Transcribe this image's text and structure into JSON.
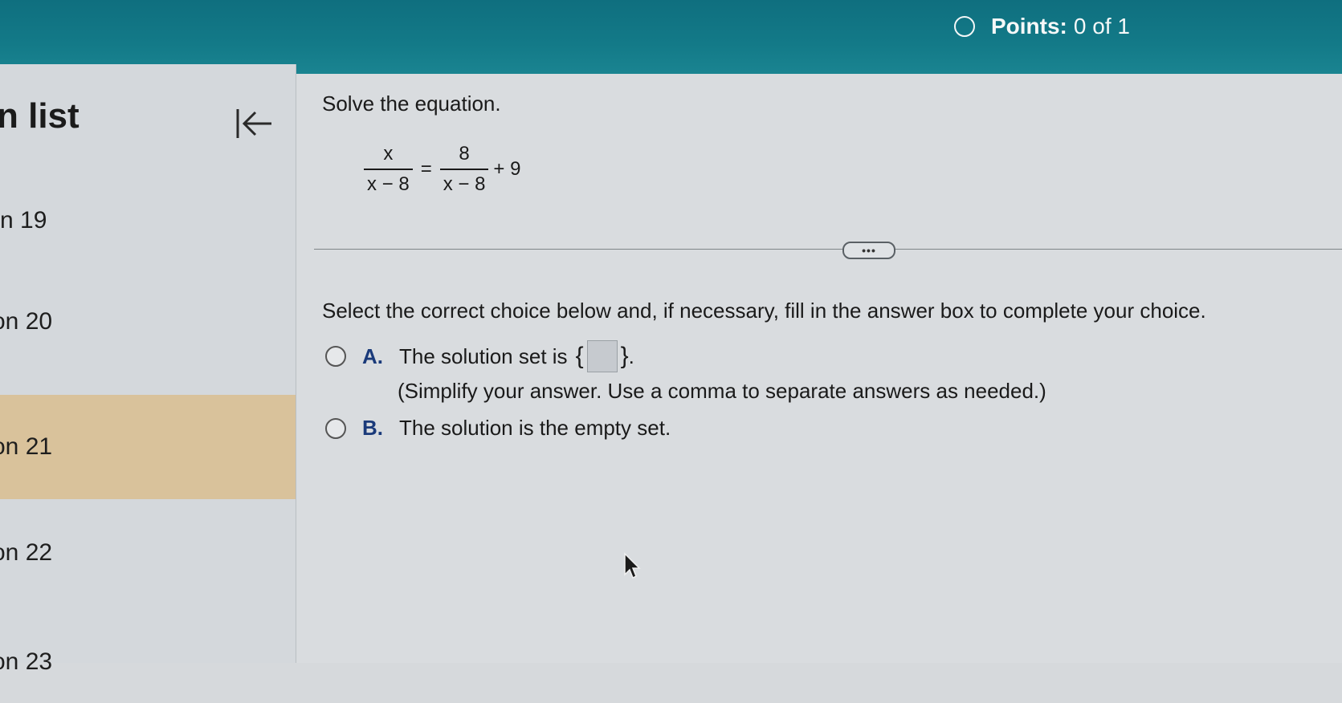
{
  "header": {
    "points_label": "Points:",
    "points_value": "0 of 1"
  },
  "sidebar": {
    "title": "n list",
    "items": [
      {
        "label": "n 19"
      },
      {
        "label": "on 20"
      },
      {
        "label": "on 21",
        "active": true
      },
      {
        "label": "on 22"
      },
      {
        "label": "on 23"
      }
    ]
  },
  "question": {
    "instruction": "Solve the equation.",
    "equation": {
      "lhs_num": "x",
      "lhs_den": "x − 8",
      "equals": "=",
      "rhs_num": "8",
      "rhs_den": "x − 8",
      "rhs_tail": "+ 9"
    },
    "more_label": "•••",
    "select_instruction": "Select the correct choice below and, if necessary, fill in the answer box to complete your choice.",
    "choices": [
      {
        "letter": "A.",
        "text": "The solution set is",
        "set_open": "{",
        "set_close": "}",
        "period": ".",
        "hint": "(Simplify your answer. Use a comma to separate answers as needed.)"
      },
      {
        "letter": "B.",
        "text": "The solution is the empty set."
      }
    ]
  },
  "colors": {
    "topbar": "#137a88",
    "active_item": "#d9c29b",
    "choice_letter": "#1a3a7a"
  }
}
